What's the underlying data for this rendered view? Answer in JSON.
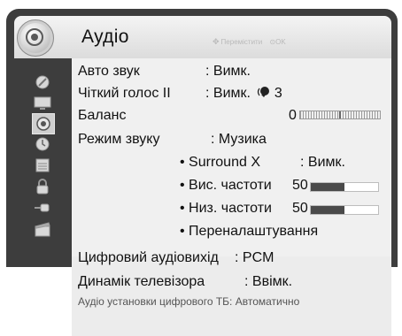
{
  "header": {
    "title": "Аудіо",
    "hint_move": "Перемістити",
    "hint_ok": "OK"
  },
  "sidebar": {
    "items": [
      {
        "icon": "dish-icon",
        "selected": false
      },
      {
        "icon": "tv-screen-icon",
        "selected": false
      },
      {
        "icon": "speaker-icon",
        "selected": true
      },
      {
        "icon": "clock-icon",
        "selected": false
      },
      {
        "icon": "list-icon",
        "selected": false
      },
      {
        "icon": "lock-icon",
        "selected": false
      },
      {
        "icon": "connector-icon",
        "selected": false
      },
      {
        "icon": "clapper-icon",
        "selected": false
      }
    ]
  },
  "menu": {
    "auto_sound_label": "Авто звук",
    "auto_sound_value": ": Вимк.",
    "clear_voice_label": "Чіткий голос II",
    "clear_voice_value": ": Вимк.",
    "clear_voice_level": "3",
    "balance_label": "Баланс",
    "balance_value": "0",
    "sound_mode_label": "Режим звуку",
    "sound_mode_value": ": Музика",
    "surround_label": "• Surround X",
    "surround_value": ": Вимк.",
    "treble_label": "• Вис. частоти",
    "treble_value": "50",
    "treble_level": 0.5,
    "bass_label": "• Низ. частоти",
    "bass_value": "50",
    "bass_level": 0.5,
    "reset_label": "• Переналаштування",
    "digital_out_label": "Цифровий аудіовихід",
    "digital_out_value": ": PCM",
    "tv_speaker_label": "Динамік телевізора",
    "tv_speaker_value": ": Ввімк.",
    "digital_tv_info": "Аудіо установки цифрового ТБ: Автоматично"
  },
  "colors": {
    "frame": "#3d3d3d",
    "panel": "#f0f0f0",
    "bar_fill": "#4a4a4a"
  }
}
